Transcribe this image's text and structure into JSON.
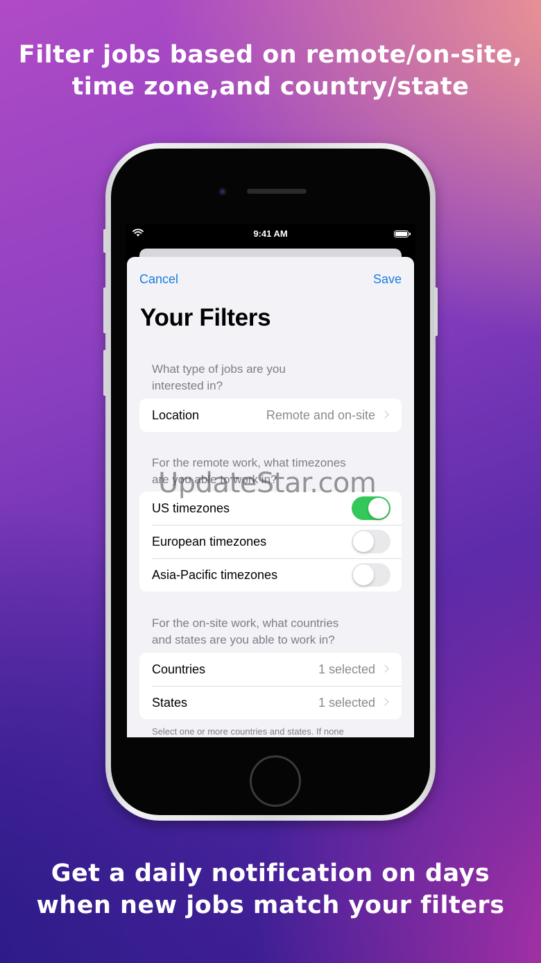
{
  "headline_top": {
    "line1": "Filter jobs based on remote/on-site,",
    "line2": "time zone,and country/state"
  },
  "headline_bottom": {
    "line1": "Get a daily notification on days",
    "line2": "when new jobs match your filters"
  },
  "status_bar": {
    "time": "9:41 AM"
  },
  "nav": {
    "cancel_label": "Cancel",
    "save_label": "Save"
  },
  "page_title": "Your Filters",
  "section_job_type": {
    "header_line1": "What type of jobs are you",
    "header_line2": "interested in?",
    "location": {
      "label": "Location",
      "value": "Remote and on-site"
    }
  },
  "section_timezones": {
    "header_line1": "For the remote work, what timezones",
    "header_line2": "are you able to work in?",
    "items": [
      {
        "label": "US timezones",
        "on": true
      },
      {
        "label": "European timezones",
        "on": false
      },
      {
        "label": "Asia-Pacific timezones",
        "on": false
      }
    ]
  },
  "section_countries": {
    "header_line1": "For the on-site work, what countries",
    "header_line2": "and states are you able to work in?",
    "countries": {
      "label": "Countries",
      "value": "1 selected"
    },
    "states": {
      "label": "States",
      "value": "1 selected"
    },
    "footer": "Select one or more countries and states. If none"
  },
  "watermark": "UpdateStar.com",
  "colors": {
    "accent": "#1a7ee0",
    "toggle_on": "#34c759",
    "toggle_off": "#e9e9eb"
  }
}
